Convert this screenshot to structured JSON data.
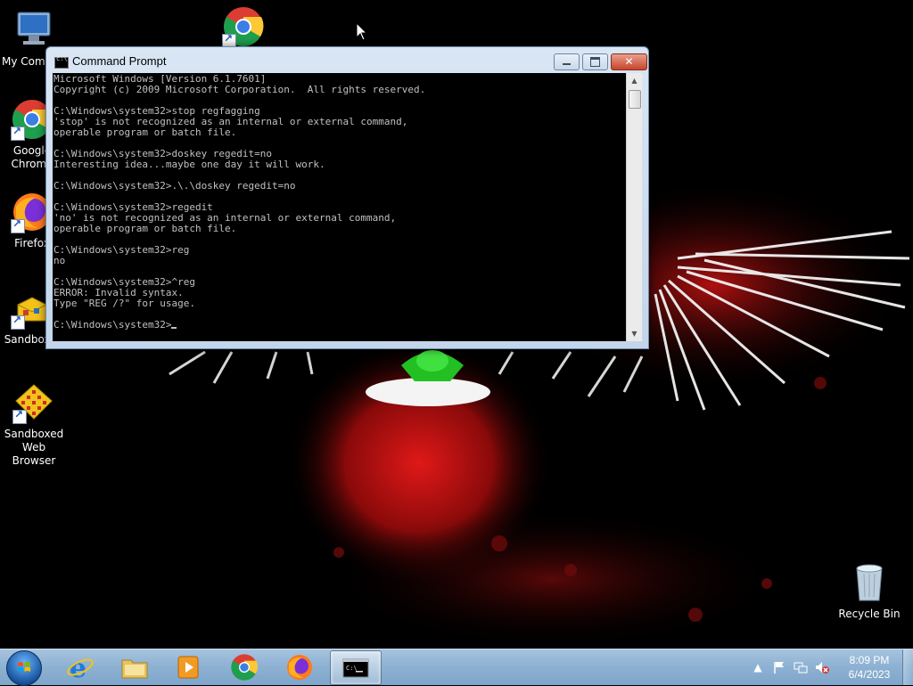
{
  "desktop": {
    "icons": [
      {
        "label": "My Comp",
        "icon": "computer-icon"
      },
      {
        "label": "Google Chrome",
        "icon": "chrome-icon"
      },
      {
        "label": "Firefox",
        "icon": "firefox-icon"
      },
      {
        "label": "Sandboxie",
        "icon": "sandboxie-icon"
      },
      {
        "label": "Sandboxed Web Browser",
        "icon": "sandboxed-browser-icon"
      },
      {
        "label": "Recycle Bin",
        "icon": "recycle-bin-icon"
      },
      {
        "label": "",
        "icon": "chrome-icon"
      }
    ]
  },
  "window": {
    "title": "Command Prompt",
    "lines": [
      "Microsoft Windows [Version 6.1.7601]",
      "Copyright (c) 2009 Microsoft Corporation.  All rights reserved.",
      "",
      "C:\\Windows\\system32>stop regfagging",
      "'stop' is not recognized as an internal or external command,",
      "operable program or batch file.",
      "",
      "C:\\Windows\\system32>doskey regedit=no",
      "Interesting idea...maybe one day it will work.",
      "",
      "C:\\Windows\\system32>.\\.\\doskey regedit=no",
      "",
      "C:\\Windows\\system32>regedit",
      "'no' is not recognized as an internal or external command,",
      "operable program or batch file.",
      "",
      "C:\\Windows\\system32>reg",
      "no",
      "",
      "C:\\Windows\\system32>^reg",
      "ERROR: Invalid syntax.",
      "Type \"REG /?\" for usage.",
      "",
      "C:\\Windows\\system32>"
    ],
    "close_glyph": "✕",
    "colors": {
      "console_bg": "#000000",
      "console_fg": "#c0c0c0",
      "close_red": "#c8442c"
    }
  },
  "taskbar": {
    "pinned": [
      {
        "name": "internet-explorer",
        "icon": "ie-icon"
      },
      {
        "name": "windows-explorer",
        "icon": "folder-icon"
      },
      {
        "name": "media-player",
        "icon": "media-player-icon"
      },
      {
        "name": "chrome",
        "icon": "chrome-icon"
      },
      {
        "name": "firefox",
        "icon": "firefox-icon"
      },
      {
        "name": "command-prompt",
        "icon": "cmd-icon",
        "active": true
      }
    ],
    "clock": {
      "time": "8:09 PM",
      "date": "6/4/2023"
    },
    "tray_icons": [
      "show-hidden-icons-icon",
      "action-center-flag-icon",
      "network-icon",
      "volume-muted-icon"
    ]
  }
}
